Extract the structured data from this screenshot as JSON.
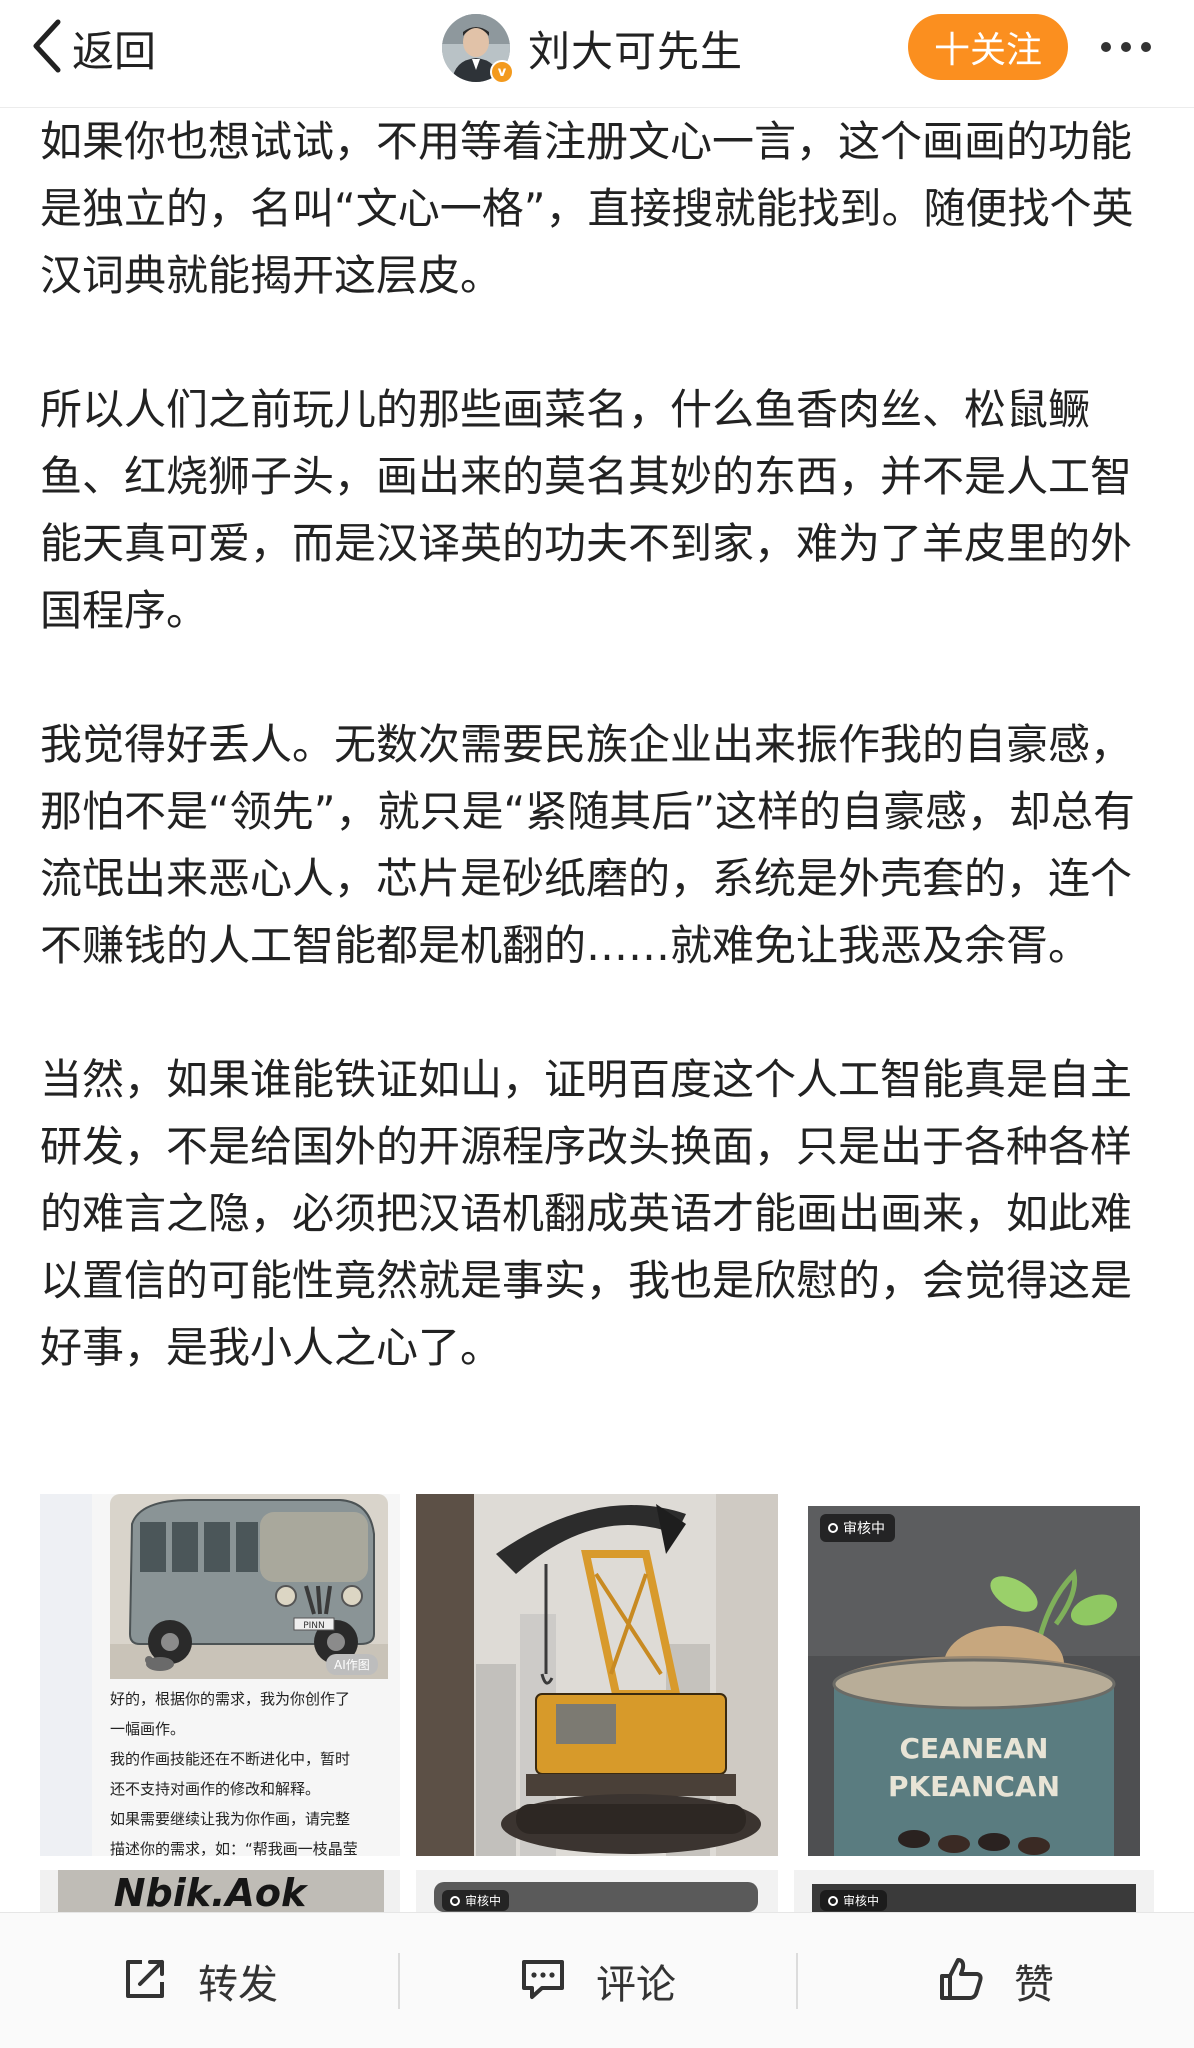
{
  "header": {
    "back_label": "返回",
    "author_name": "刘大可先生",
    "verified_badge": "v",
    "follow_label": "十关注",
    "more_icon": "more-dots-icon"
  },
  "post": {
    "paragraphs": [
      "如果你也想试试，不用等着注册文心一言，这个画画的功能是独立的，名叫“文心一格”，直接搜就能找到。随便找个英汉词典就能揭开这层皮。",
      "所以人们之前玩儿的那些画菜名，什么鱼香肉丝、松鼠鳜鱼、红烧狮子头，画出来的莫名其妙的东西，并不是人工智能天真可爱，而是汉译英的功夫不到家，难为了羊皮里的外国程序。",
      "我觉得好丢人。无数次需要民族企业出来振作我的自豪感，那怕不是“领先”，就只是“紧随其后”这样的自豪感，却总有流氓出来恶心人，芯片是砂纸磨的，系统是外壳套的，连个不赚钱的人工智能都是机翻的……就难免让我恶及余胥。",
      "当然，如果谁能铁证如山，证明百度这个人工智能真是自主研发，不是给国外的开源程序改头换面，只是出于各种各样的难言之隐，必须把汉语机翻成英语才能画出画来，如此难以置信的可能性竟然就是事实，我也是欣慰的，会觉得这是好事，是我小人之心了。"
    ]
  },
  "images": {
    "img1": {
      "ai_tag": "AI作图",
      "chat_lines": [
        "好的，根据你的需求，我为你创作了",
        "一幅画作。",
        "我的作画技能还在不断进化中，暂时",
        "还不支持对画作的修改和解释。",
        "如果需要继续让我为你作画，请完整",
        "描述你的需求，如：“帮我画一枝晶莹"
      ],
      "bus_plate": "PINN"
    },
    "img3": {
      "review_badge": "审核中",
      "can_text_1": "CEANEAN",
      "can_text_2": "PKEANCAN"
    },
    "img4_text": "Nbik.Aok",
    "img5": {
      "review_badge": "审核中"
    },
    "img6": {
      "review_badge": "审核中"
    }
  },
  "bottom_bar": {
    "repost_label": "转发",
    "comment_label": "评论",
    "like_label": "赞"
  },
  "colors": {
    "follow_button": "#fb8f1f",
    "verified_badge": "#f39a1e",
    "text": "#222222"
  }
}
